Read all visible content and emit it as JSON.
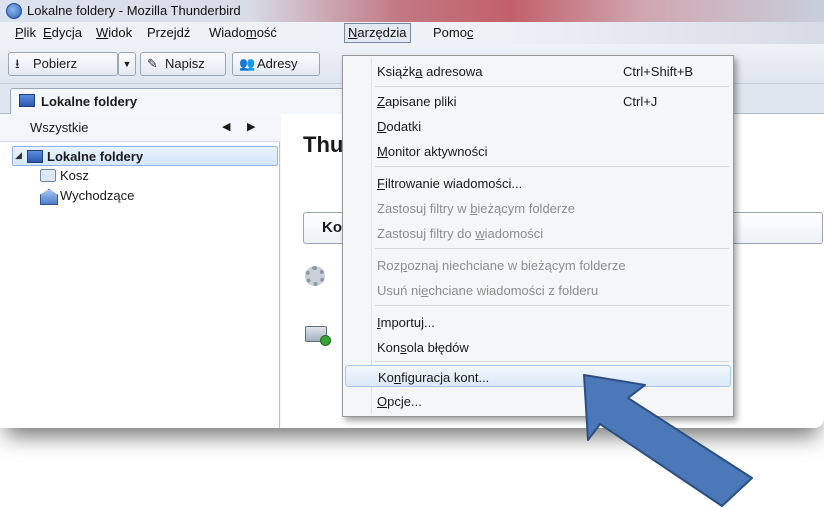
{
  "window": {
    "title": "Lokalne foldery - Mozilla Thunderbird"
  },
  "menubar": {
    "items": [
      {
        "pre": "",
        "u": "P",
        "post": "lik"
      },
      {
        "pre": "",
        "u": "E",
        "post": "dycja"
      },
      {
        "pre": "",
        "u": "W",
        "post": "idok"
      },
      {
        "pre": "Prze",
        "u": "j",
        "post": "dź"
      },
      {
        "pre": "Wiado",
        "u": "m",
        "post": "ość"
      },
      {
        "pre": "",
        "u": "N",
        "post": "arzędzia"
      },
      {
        "pre": "Pomo",
        "u": "c",
        "post": ""
      }
    ]
  },
  "toolbar": {
    "get_label": "Pobierz",
    "write_label": "Napisz",
    "address_label": "Adresy"
  },
  "tab": {
    "label": "Lokalne foldery"
  },
  "sidebar": {
    "header": "Wszystkie",
    "folders": {
      "local": "Lokalne foldery",
      "trash": "Kosz",
      "outbox": "Wychodzące"
    }
  },
  "content": {
    "title": "Thu",
    "button_label": "Ko"
  },
  "dropdown": {
    "items": [
      {
        "pre": "Książk",
        "u": "a",
        "post": " adresowa",
        "shortcut": "Ctrl+Shift+B",
        "disabled": false
      },
      {
        "pre": "",
        "u": "Z",
        "post": "apisane pliki",
        "shortcut": "Ctrl+J",
        "disabled": false
      },
      {
        "pre": "",
        "u": "D",
        "post": "odatki",
        "shortcut": "",
        "disabled": false
      },
      {
        "pre": "",
        "u": "M",
        "post": "onitor aktywności",
        "shortcut": "",
        "disabled": false
      },
      {
        "pre": "",
        "u": "F",
        "post": "iltrowanie wiadomości...",
        "shortcut": "",
        "disabled": false
      },
      {
        "pre": "Zastosuj filtry w ",
        "u": "b",
        "post": "ieżącym folderze",
        "shortcut": "",
        "disabled": true
      },
      {
        "pre": "Zastosuj filtry do ",
        "u": "w",
        "post": "iadomości",
        "shortcut": "",
        "disabled": true
      },
      {
        "pre": "Roz",
        "u": "p",
        "post": "oznaj niechciane w bieżącym folderze",
        "shortcut": "",
        "disabled": true
      },
      {
        "pre": "Usuń ni",
        "u": "e",
        "post": "chciane wiadomości z folderu",
        "shortcut": "",
        "disabled": true
      },
      {
        "pre": "",
        "u": "I",
        "post": "mportuj...",
        "shortcut": "",
        "disabled": false
      },
      {
        "pre": "Kon",
        "u": "s",
        "post": "ola błędów",
        "shortcut": "",
        "disabled": false
      },
      {
        "pre": "Ko",
        "u": "n",
        "post": "figuracja kont...",
        "shortcut": "",
        "disabled": false,
        "highlighted": true
      },
      {
        "pre": "",
        "u": "O",
        "post": "pcje...",
        "shortcut": "",
        "disabled": false
      }
    ]
  },
  "colors": {
    "arrow_fill": "#4a78b8",
    "arrow_stroke": "#2b4f82",
    "highlight": "#dce9f8"
  }
}
